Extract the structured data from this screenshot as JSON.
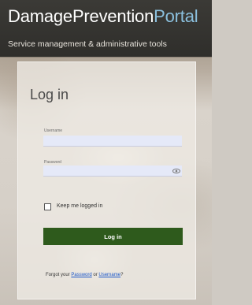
{
  "header": {
    "brand_main": "DamagePrevention",
    "brand_accent": "Portal",
    "tagline": "Service management & administrative tools"
  },
  "login": {
    "title": "Log in",
    "username_label": "Username",
    "username_value": "",
    "password_label": "Password",
    "password_value": "",
    "remember_label": "Keep me logged in",
    "remember_checked": false,
    "submit_label": "Log in"
  },
  "forgot": {
    "prefix": "Forgot your ",
    "password_link": "Password",
    "or_text": " or ",
    "username_link": "Username",
    "suffix": "?"
  },
  "icons": {
    "password_toggle": "eye-icon"
  },
  "colors": {
    "header_bg": "#2f2e2b",
    "brand_accent": "#8bc0de",
    "button_bg": "#2e5a1c",
    "input_bg": "#e5e9f8",
    "link": "#1a56c9"
  }
}
